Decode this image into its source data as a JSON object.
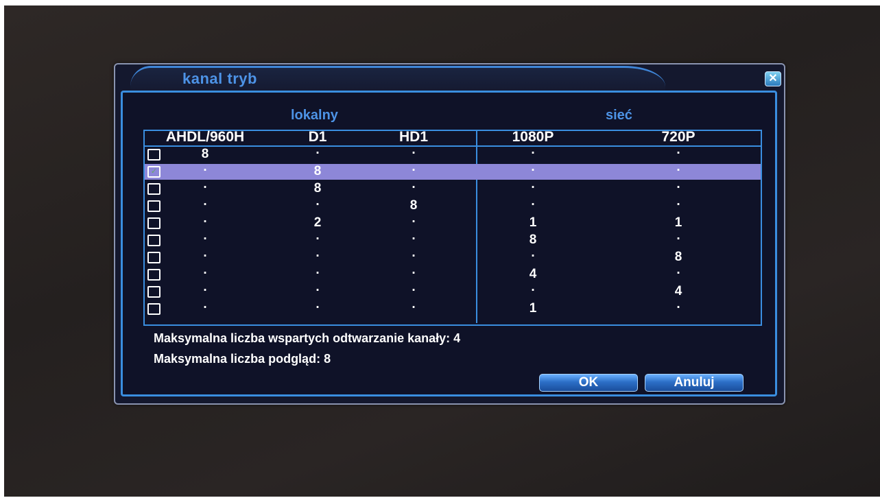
{
  "dialog": {
    "title": "kanal tryb",
    "close_icon": "close-icon"
  },
  "groups": {
    "local": "lokalny",
    "network": "sieć"
  },
  "columns": [
    "AHDL/960H",
    "D1",
    "HD1",
    "1080P",
    "720P"
  ],
  "rows": [
    {
      "checked": false,
      "selected": false,
      "values": [
        "8",
        ".",
        ".",
        ".",
        "."
      ]
    },
    {
      "checked": true,
      "selected": true,
      "values": [
        ".",
        "8",
        ".",
        ".",
        "."
      ]
    },
    {
      "checked": false,
      "selected": false,
      "values": [
        ".",
        "8",
        ".",
        ".",
        "."
      ]
    },
    {
      "checked": false,
      "selected": false,
      "values": [
        ".",
        ".",
        "8",
        ".",
        "."
      ]
    },
    {
      "checked": false,
      "selected": false,
      "values": [
        ".",
        "2",
        ".",
        "1",
        "1"
      ]
    },
    {
      "checked": false,
      "selected": false,
      "values": [
        ".",
        ".",
        ".",
        "8",
        "."
      ]
    },
    {
      "checked": false,
      "selected": false,
      "values": [
        ".",
        ".",
        ".",
        ".",
        "8"
      ]
    },
    {
      "checked": false,
      "selected": false,
      "values": [
        ".",
        ".",
        ".",
        "4",
        "."
      ]
    },
    {
      "checked": false,
      "selected": false,
      "values": [
        ".",
        ".",
        ".",
        ".",
        "4"
      ]
    },
    {
      "checked": false,
      "selected": false,
      "values": [
        ".",
        ".",
        ".",
        "1",
        "."
      ]
    }
  ],
  "info": {
    "playback": "Maksymalna liczba wspartych odtwarzanie kanały: 4",
    "preview": "Maksymalna liczba podgląd: 8"
  },
  "buttons": {
    "ok": "OK",
    "cancel": "Anuluj"
  },
  "colors": {
    "accent": "#3a8ee0",
    "title": "#4d93e6",
    "selected_row": "#8d87d8",
    "background": "#14182e"
  }
}
